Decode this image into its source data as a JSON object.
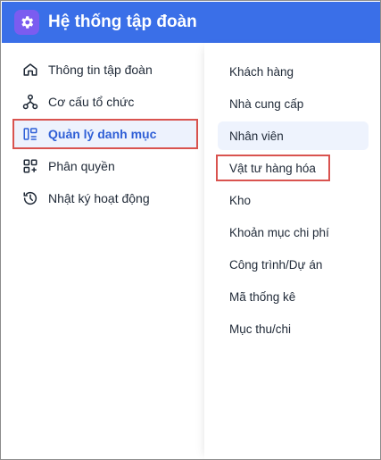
{
  "header": {
    "title": "Hệ thống tập đoàn",
    "logo_icon": "gear-icon",
    "background": "#3a6fe8"
  },
  "left_nav": {
    "items": [
      {
        "label": "Thông tin tập đoàn",
        "icon": "home-icon",
        "active": false
      },
      {
        "label": "Cơ cấu tổ chức",
        "icon": "org-chart-icon",
        "active": false
      },
      {
        "label": "Quản lý danh mục",
        "icon": "category-icon",
        "active": true
      },
      {
        "label": "Phân quyền",
        "icon": "grid-plus-icon",
        "active": false
      },
      {
        "label": "Nhật ký hoạt động",
        "icon": "history-icon",
        "active": false
      }
    ]
  },
  "submenu": {
    "items": [
      {
        "label": "Khách hàng"
      },
      {
        "label": "Nhà cung cấp"
      },
      {
        "label": "Nhân viên",
        "state": "hover"
      },
      {
        "label": "Vật tư hàng hóa",
        "state": "highlighted"
      },
      {
        "label": "Kho"
      },
      {
        "label": "Khoản mục chi phí"
      },
      {
        "label": "Công trình/Dự án"
      },
      {
        "label": "Mã thống kê"
      },
      {
        "label": "Mục thu/chi"
      }
    ]
  },
  "colors": {
    "accent": "#2f5fd6",
    "highlight_border": "#d9534f",
    "hover_bg": "#eef3fd"
  }
}
